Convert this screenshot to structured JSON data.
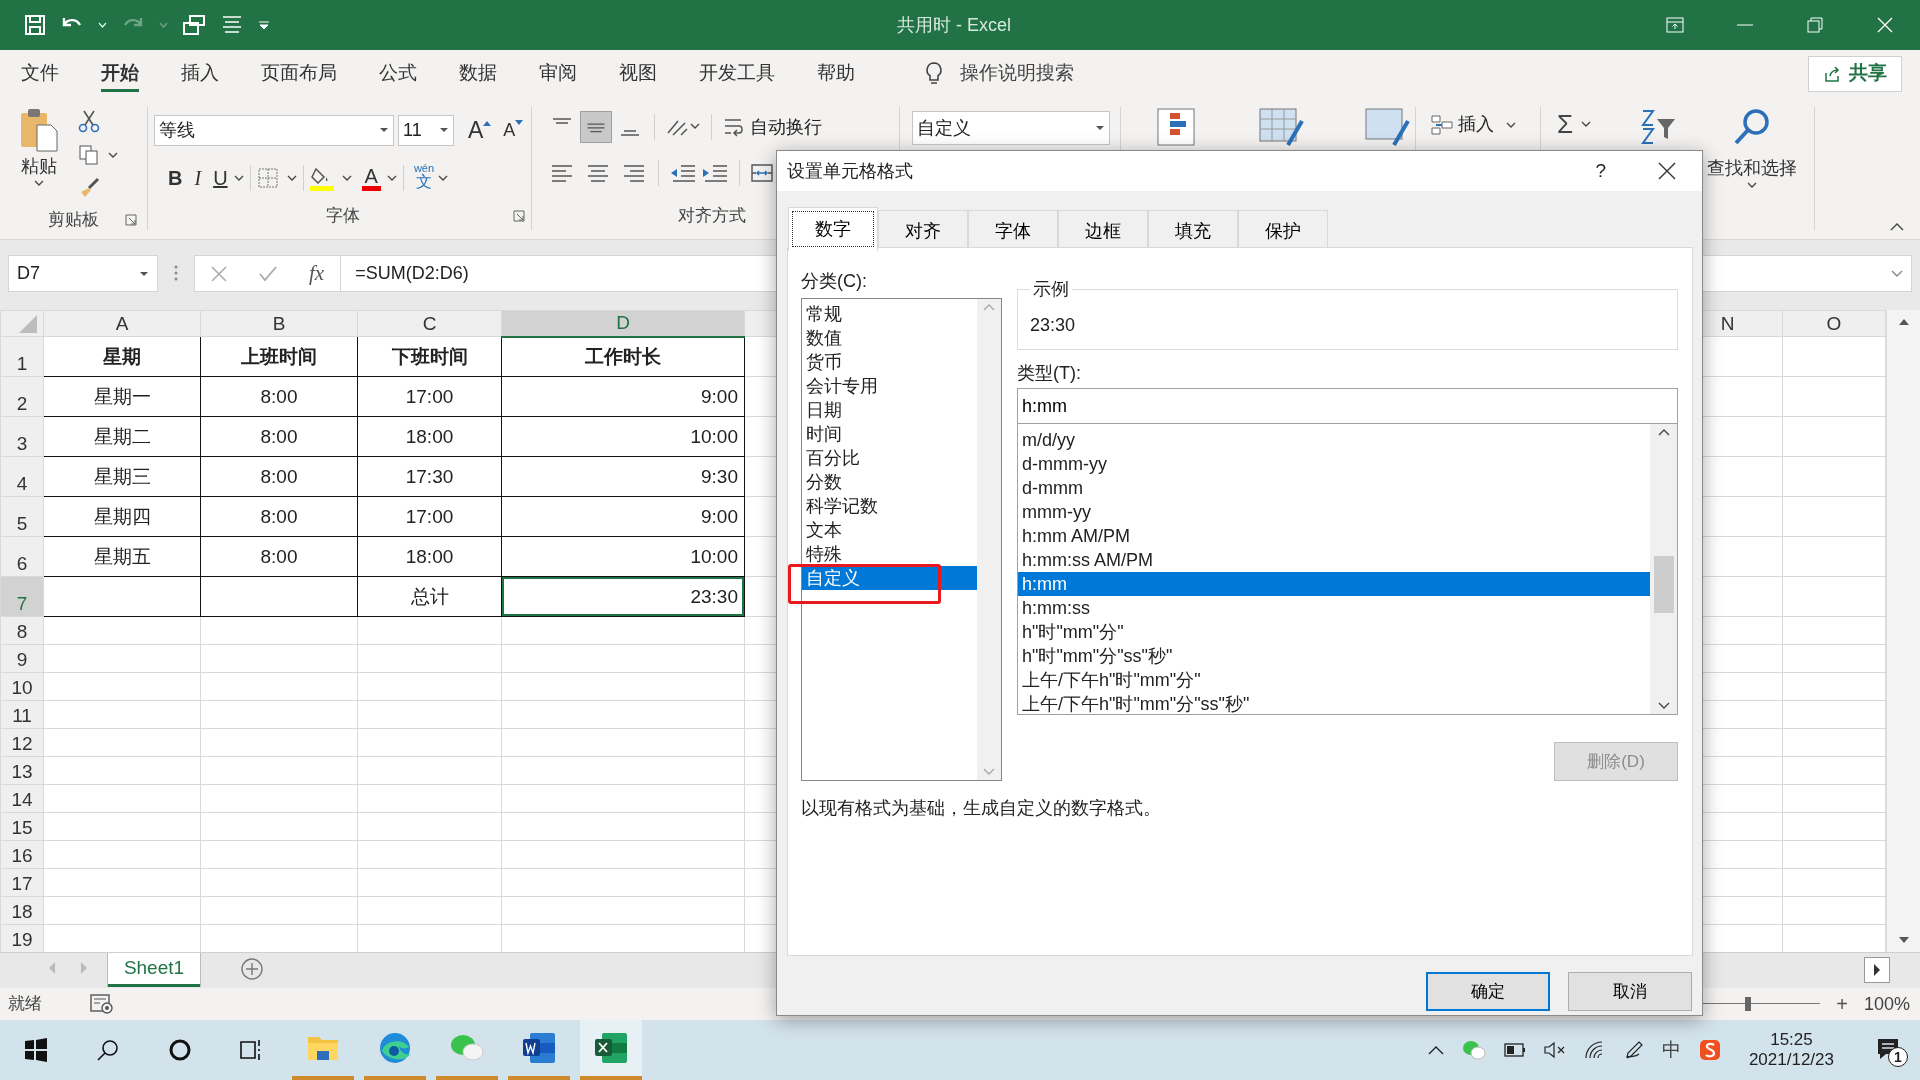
{
  "window": {
    "title": "共用时  -  Excel"
  },
  "ribbon_tabs": [
    {
      "label": "文件",
      "selected": false
    },
    {
      "label": "开始",
      "selected": true
    },
    {
      "label": "插入",
      "selected": false
    },
    {
      "label": "页面布局",
      "selected": false
    },
    {
      "label": "公式",
      "selected": false
    },
    {
      "label": "数据",
      "selected": false
    },
    {
      "label": "审阅",
      "selected": false
    },
    {
      "label": "视图",
      "selected": false
    },
    {
      "label": "开发工具",
      "selected": false
    },
    {
      "label": "帮助",
      "selected": false
    }
  ],
  "tell_me": {
    "label": "操作说明搜索"
  },
  "share": {
    "label": "共享"
  },
  "clipboard": {
    "paste": "粘贴",
    "group": "剪贴板"
  },
  "font": {
    "name": "等线",
    "size": "11",
    "grow": "A",
    "shrink": "A",
    "bold": "B",
    "italic": "I",
    "underline": "U",
    "color_letter": "A",
    "phonetic_top": "wén",
    "phonetic_char": "文",
    "group": "字体"
  },
  "alignment": {
    "wrap": "自动换行",
    "group": "对齐方式"
  },
  "number_format": {
    "value": "自定义"
  },
  "cells": {
    "insert": "插入"
  },
  "editing": {
    "sum": "Σ",
    "find": "查找和选择"
  },
  "formula_bar": {
    "name_box": "D7",
    "fx": "fx",
    "formula": "=SUM(D2:D6)"
  },
  "sheet": {
    "columns": [
      {
        "label": "A",
        "selected": false,
        "kind": "centered"
      },
      {
        "label": "B",
        "selected": false,
        "kind": "centered"
      },
      {
        "label": "C",
        "selected": false,
        "kind": "centered"
      },
      {
        "label": "D",
        "selected": true,
        "kind": "numeric"
      }
    ],
    "far_columns": [
      {
        "label": "N",
        "selected": false
      },
      {
        "label": "O",
        "selected": false
      }
    ],
    "rows": [
      {
        "number": "1",
        "selected": false,
        "kind": "header",
        "bordered": true,
        "cells": [
          "星期",
          "上班时间",
          "下班时间",
          "工作时长"
        ]
      },
      {
        "number": "2",
        "selected": false,
        "kind": "data",
        "bordered": true,
        "cells": [
          "星期一",
          "8:00",
          "17:00",
          "9:00"
        ]
      },
      {
        "number": "3",
        "selected": false,
        "kind": "data",
        "bordered": true,
        "cells": [
          "星期二",
          "8:00",
          "18:00",
          "10:00"
        ]
      },
      {
        "number": "4",
        "selected": false,
        "kind": "data",
        "bordered": true,
        "cells": [
          "星期三",
          "8:00",
          "17:30",
          "9:30"
        ]
      },
      {
        "number": "5",
        "selected": false,
        "kind": "data",
        "bordered": true,
        "cells": [
          "星期四",
          "8:00",
          "17:00",
          "9:00"
        ]
      },
      {
        "number": "6",
        "selected": false,
        "kind": "data",
        "bordered": true,
        "cells": [
          "星期五",
          "8:00",
          "18:00",
          "10:00"
        ]
      },
      {
        "number": "7",
        "selected": true,
        "kind": "data",
        "bordered": true,
        "cells": [
          null,
          null,
          "总计",
          "23:30"
        ]
      },
      {
        "number": "8",
        "selected": false,
        "kind": "blank",
        "bordered": false
      },
      {
        "number": "9",
        "selected": false,
        "kind": "blank",
        "bordered": false
      },
      {
        "number": "10",
        "selected": false,
        "kind": "blank",
        "bordered": false
      },
      {
        "number": "11",
        "selected": false,
        "kind": "blank",
        "bordered": false
      },
      {
        "number": "12",
        "selected": false,
        "kind": "blank",
        "bordered": false
      },
      {
        "number": "13",
        "selected": false,
        "kind": "blank",
        "bordered": false
      },
      {
        "number": "14",
        "selected": false,
        "kind": "blank",
        "bordered": false
      },
      {
        "number": "15",
        "selected": false,
        "kind": "blank",
        "bordered": false
      },
      {
        "number": "16",
        "selected": false,
        "kind": "blank",
        "bordered": false
      },
      {
        "number": "17",
        "selected": false,
        "kind": "blank",
        "bordered": false
      },
      {
        "number": "18",
        "selected": false,
        "kind": "blank",
        "bordered": false
      },
      {
        "number": "19",
        "selected": false,
        "kind": "blank",
        "bordered": false
      }
    ]
  },
  "sheet_tabs": [
    {
      "label": "Sheet1",
      "selected": true
    }
  ],
  "status": {
    "text": "就绪"
  },
  "zoom": {
    "level": 0.67,
    "plus": "+",
    "reading": "100%"
  },
  "taskbar": {
    "buttons": [
      {
        "kind": "start",
        "running": false,
        "active": false
      },
      {
        "kind": "search",
        "running": false,
        "active": false
      },
      {
        "kind": "cortana",
        "running": false,
        "active": false
      },
      {
        "kind": "taskview",
        "running": false,
        "active": false
      },
      {
        "kind": "explorer",
        "running": true,
        "active": false
      },
      {
        "kind": "edge",
        "running": true,
        "active": false
      },
      {
        "kind": "wechat",
        "running": true,
        "active": false
      },
      {
        "kind": "word",
        "running": true,
        "active": false
      },
      {
        "kind": "excel",
        "running": true,
        "active": true
      }
    ]
  },
  "tray": {
    "ime": "中",
    "time": "15:25",
    "date": "2021/12/23",
    "notifications": "1"
  },
  "dialog": {
    "title": "设置单元格格式",
    "help": "?",
    "tabs": [
      {
        "label": "数字",
        "selected": true
      },
      {
        "label": "对齐",
        "selected": false
      },
      {
        "label": "字体",
        "selected": false
      },
      {
        "label": "边框",
        "selected": false
      },
      {
        "label": "填充",
        "selected": false
      },
      {
        "label": "保护",
        "selected": false
      }
    ],
    "category_label": "分类(C):",
    "categories": [
      {
        "label": "常规",
        "selected": false
      },
      {
        "label": "数值",
        "selected": false
      },
      {
        "label": "货币",
        "selected": false
      },
      {
        "label": "会计专用",
        "selected": false
      },
      {
        "label": "日期",
        "selected": false
      },
      {
        "label": "时间",
        "selected": false
      },
      {
        "label": "百分比",
        "selected": false
      },
      {
        "label": "分数",
        "selected": false
      },
      {
        "label": "科学记数",
        "selected": false
      },
      {
        "label": "文本",
        "selected": false
      },
      {
        "label": "特殊",
        "selected": false
      },
      {
        "label": "自定义",
        "selected": true
      }
    ],
    "sample_label": "示例",
    "sample": "23:30",
    "type_label": "类型(T):",
    "type_value": "h:mm",
    "types": [
      {
        "label": "m/d/yy",
        "selected": false
      },
      {
        "label": "d-mmm-yy",
        "selected": false
      },
      {
        "label": "d-mmm",
        "selected": false
      },
      {
        "label": "mmm-yy",
        "selected": false
      },
      {
        "label": "h:mm AM/PM",
        "selected": false
      },
      {
        "label": "h:mm:ss AM/PM",
        "selected": false
      },
      {
        "label": "h:mm",
        "selected": true
      },
      {
        "label": "h:mm:ss",
        "selected": false
      },
      {
        "label": "h\"时\"mm\"分\"",
        "selected": false
      },
      {
        "label": "h\"时\"mm\"分\"ss\"秒\"",
        "selected": false
      },
      {
        "label": "上午/下午h\"时\"mm\"分\"",
        "selected": false
      },
      {
        "label": "上午/下午h\"时\"mm\"分\"ss\"秒\"",
        "selected": false
      }
    ],
    "delete_button": {
      "label": "删除(D)",
      "disabled": true
    },
    "description": "以现有格式为基础，生成自定义的数字格式。",
    "buttons": [
      {
        "label": "确定",
        "default": true
      },
      {
        "label": "取消",
        "default": false
      }
    ]
  }
}
